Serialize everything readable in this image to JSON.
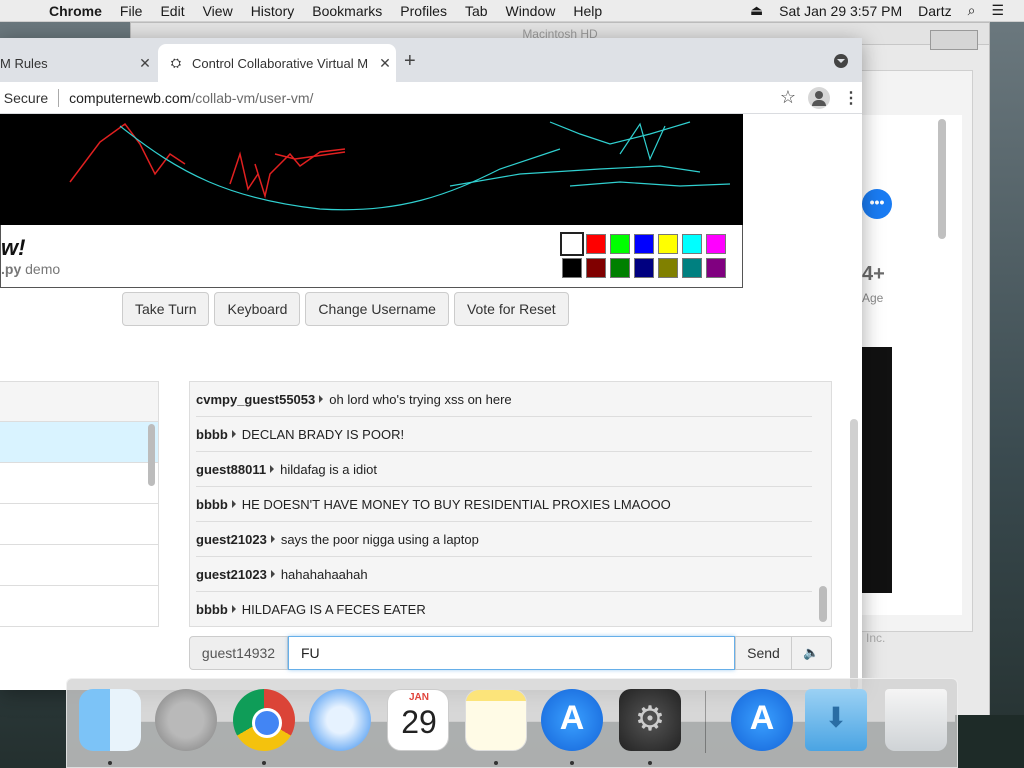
{
  "menubar": {
    "app": "Chrome",
    "items": [
      "File",
      "Edit",
      "View",
      "History",
      "Bookmarks",
      "Profiles",
      "Tab",
      "Window",
      "Help"
    ],
    "datetime": "Sat Jan 29  3:57 PM",
    "user": "Dartz"
  },
  "background_window": {
    "title": "Macintosh HD",
    "age_rating": "4+",
    "age_label": "Age",
    "footer": "Inc."
  },
  "browser": {
    "tabs": [
      {
        "title": "M Rules"
      },
      {
        "title": "Control Collaborative Virtual M"
      }
    ],
    "security": "t Secure",
    "url_domain": "computernewb.com",
    "url_path": "/collab-vm/user-vm/"
  },
  "vm": {
    "title": "w!",
    "subtitle_prefix": ".py",
    "subtitle_suffix": " demo",
    "palette": {
      "top": [
        "#ffffff",
        "#ff0000",
        "#00ff00",
        "#0000ff",
        "#ffff00",
        "#00ffff",
        "#ff00ff"
      ],
      "bottom": [
        "#000000",
        "#800000",
        "#008000",
        "#000080",
        "#808000",
        "#008080",
        "#800080"
      ]
    }
  },
  "buttons": {
    "take_turn": "Take Turn",
    "keyboard": "Keyboard",
    "change_username": "Change Username",
    "vote_reset": "Vote for Reset"
  },
  "chat": {
    "messages": [
      {
        "user": "cvmpy_guest55053",
        "text": "oh lord who's trying xss on here"
      },
      {
        "user": "bbbb",
        "text": "DECLAN BRADY IS POOR!"
      },
      {
        "user": "guest88011",
        "text": "hildafag is a idiot"
      },
      {
        "user": "bbbb",
        "text": "HE DOESN'T HAVE MONEY TO BUY RESIDENTIAL PROXIES LMAOOO"
      },
      {
        "user": "guest21023",
        "text": "says the poor nigga using a laptop"
      },
      {
        "user": "guest21023",
        "text": "hahahahaahah"
      },
      {
        "user": "bbbb",
        "text": "HILDAFAG IS A FECES EATER"
      }
    ],
    "username": "guest14932",
    "input_value": "FU",
    "send_label": "Send"
  },
  "dock": {
    "calendar_month": "JAN",
    "calendar_day": "29"
  }
}
